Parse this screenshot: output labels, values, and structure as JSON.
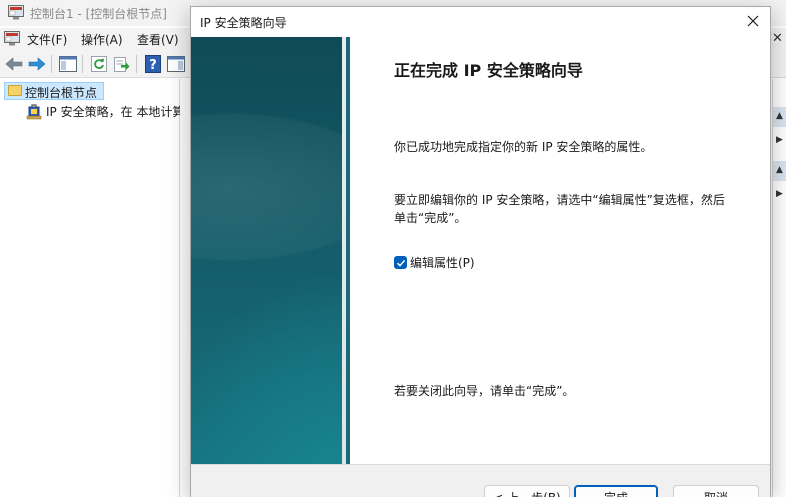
{
  "mmc": {
    "title": "控制台1 - [控制台根节点]",
    "menu": [
      {
        "label": "文件(F)"
      },
      {
        "label": "操作(A)"
      },
      {
        "label": "查看(V)"
      }
    ],
    "tree": {
      "root": "控制台根节点",
      "child": "IP 安全策略，在 本地计算机"
    },
    "toolbar_icons": [
      "back-icon",
      "forward-icon",
      "show-hide-tree-icon",
      "refresh-icon",
      "export-list-icon",
      "help-icon",
      "show-hide-action-pane-icon"
    ]
  },
  "wizard": {
    "title": "IP 安全策略向导",
    "heading": "正在完成 IP 安全策略向导",
    "line1": "你已成功地完成指定你的新 IP 安全策略的属性。",
    "line2": "要立即编辑你的 IP 安全策略，请选中“编辑属性”复选框，然后单击“完成”。",
    "checkbox": {
      "label": "编辑属性(P)",
      "checked": true
    },
    "line3": "若要关闭此向导，请单击“完成”。",
    "buttons": {
      "back": "< 上一步(B)",
      "finish": "完成",
      "cancel": "取消"
    }
  },
  "colors": {
    "accent": "#005fb8",
    "banner_dark": "#0f4a57",
    "banner_light": "#1b8f97",
    "selection": "#cce8ff"
  }
}
